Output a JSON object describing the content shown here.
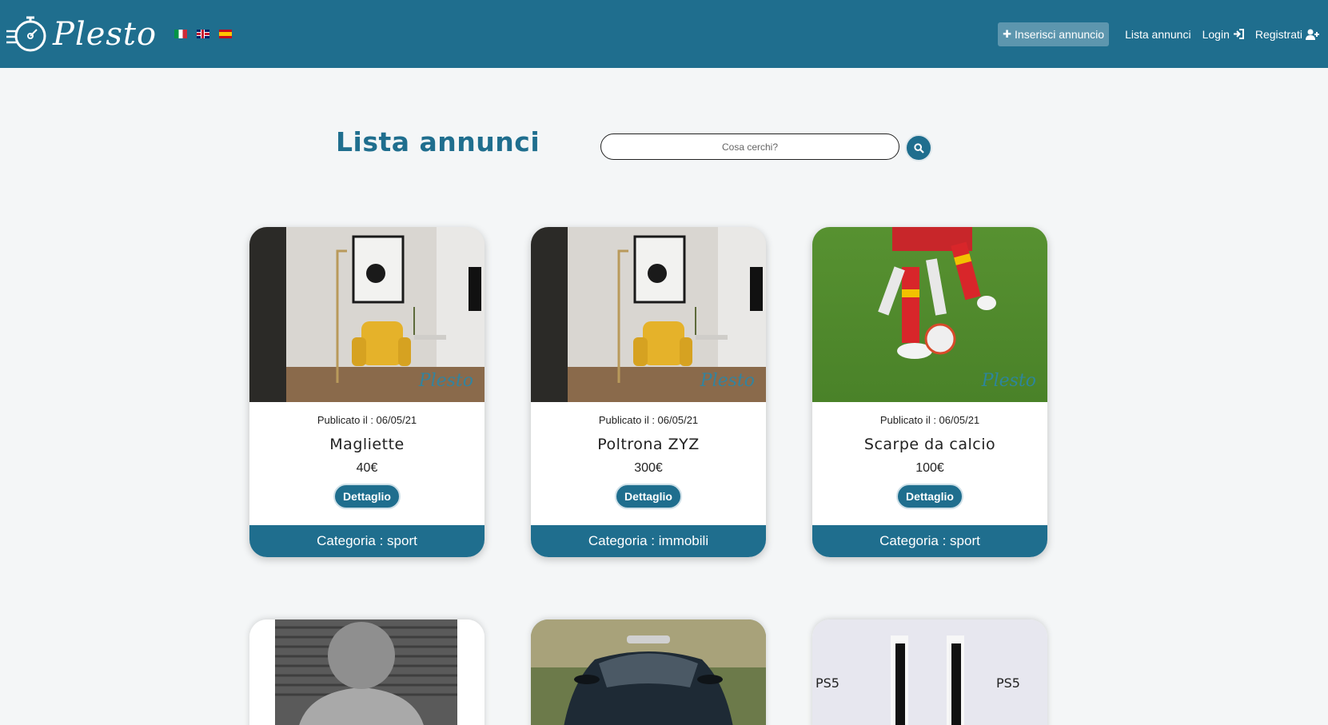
{
  "brand": {
    "name": "Plesto",
    "watermark": "Plesto"
  },
  "nav": {
    "insert_label": "Inserisci annuncio",
    "list_label": "Lista annunci",
    "login_label": "Login",
    "register_label": "Registrati"
  },
  "main": {
    "title": "Lista annunci",
    "search_placeholder": "Cosa cerchi?"
  },
  "cards": [
    {
      "date": "Publicato il : 06/05/21",
      "title": "Magliette",
      "price": "40€",
      "button": "Dettaglio",
      "category": "Categoria : sport"
    },
    {
      "date": "Publicato il : 06/05/21",
      "title": "Poltrona ZYZ",
      "price": "300€",
      "button": "Dettaglio",
      "category": "Categoria : immobili"
    },
    {
      "date": "Publicato il : 06/05/21",
      "title": "Scarpe da calcio",
      "price": "100€",
      "button": "Dettaglio",
      "category": "Categoria : sport"
    }
  ],
  "ps5_logo_text": "PS5",
  "colors": {
    "primary": "#1f6e8e",
    "background": "#f4f6f7",
    "insert_button": "#5d96ae"
  }
}
